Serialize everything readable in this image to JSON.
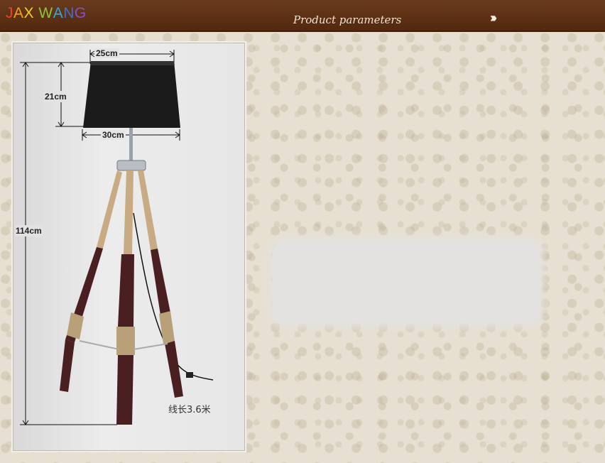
{
  "header": {
    "brand": "JAX WANG",
    "title": "Product parameters",
    "next_icon": "double-chevron-right-icon"
  },
  "colors": {
    "header_bg": "#5b2f14",
    "brand_letters": [
      "#e8432c",
      "#f4a11c",
      "#f5d21a",
      "#8fc43d",
      "#31a9e0",
      "#3d6fd1",
      "#8a4fc7",
      "#e8432c"
    ]
  },
  "dimensions": {
    "shade_top": "25cm",
    "shade_height": "21cm",
    "shade_bottom": "30cm",
    "total_height": "114cm"
  },
  "note": "线长3.6米"
}
